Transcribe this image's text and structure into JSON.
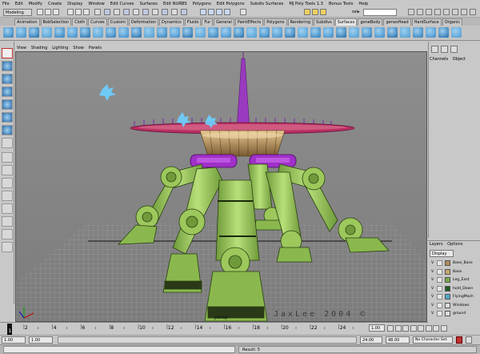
{
  "menubar": [
    "File",
    "Edit",
    "Modify",
    "Create",
    "Display",
    "Window",
    "Edit Curves",
    "Surfaces",
    "Edit NURBS",
    "Polygons",
    "Edit Polygons",
    "Subdiv Surfaces",
    "MJ Poly Tools 1.3",
    "Bonus Tools",
    "Help"
  ],
  "status": {
    "mode": "Modeling",
    "sel_label": "sel▸"
  },
  "shelf_tabs": [
    {
      "label": "Animation",
      "active": false
    },
    {
      "label": "BobSelection",
      "active": false
    },
    {
      "label": "Cloth",
      "active": false
    },
    {
      "label": "Curves",
      "active": false
    },
    {
      "label": "Custom",
      "active": false
    },
    {
      "label": "Deformation",
      "active": false
    },
    {
      "label": "Dynamics",
      "active": false
    },
    {
      "label": "Fluids",
      "active": false
    },
    {
      "label": "Fur",
      "active": false
    },
    {
      "label": "General",
      "active": false
    },
    {
      "label": "PaintEffects",
      "active": false
    },
    {
      "label": "Polygons",
      "active": false
    },
    {
      "label": "Rendering",
      "active": false
    },
    {
      "label": "Subdivs",
      "active": false
    },
    {
      "label": "Surfaces",
      "active": true
    },
    {
      "label": "geneBody",
      "active": false
    },
    {
      "label": "genesHead",
      "active": false
    },
    {
      "label": "HardSurface",
      "active": false
    },
    {
      "label": "Organic",
      "active": false
    }
  ],
  "panel_menu": [
    "View",
    "Shading",
    "Lighting",
    "Show",
    "Panels"
  ],
  "viewport": {
    "camera": "persp",
    "watermark": "JaxLee 2004 ©"
  },
  "channel_box": {
    "menus": [
      "Channels",
      "Object"
    ]
  },
  "layers": {
    "menus": [
      "Layers",
      "Options"
    ],
    "dropdown": "Display",
    "rows": [
      {
        "v": "V",
        "name": "Base_Base",
        "color": "#b08a5a"
      },
      {
        "v": "V",
        "name": "Base",
        "color": "#c8a870"
      },
      {
        "v": "V",
        "name": "Leg_East",
        "color": "#7aa84a"
      },
      {
        "v": "V",
        "name": "hold_Down",
        "color": "#1e5c1e"
      },
      {
        "v": "V",
        "name": "FlyingMach",
        "color": "#4caacc"
      },
      {
        "v": "V",
        "name": "Windows",
        "color": "#dcdcdc"
      },
      {
        "v": "V",
        "name": "ground",
        "color": "#dcdcdc"
      }
    ]
  },
  "timeline": {
    "ticks": [
      "2",
      "4",
      "6",
      "8",
      "10",
      "12",
      "14",
      "16",
      "18",
      "20",
      "22",
      "24"
    ],
    "current_frame": "1",
    "frame_field": "1.00"
  },
  "range": {
    "start": "1.00",
    "start2": "1.00",
    "end": "24.00",
    "end2": "48.00",
    "char_set": "No Character Set"
  },
  "command": {
    "result": "Result: 5"
  },
  "colors": {
    "ui_gray": "#c8c8c8",
    "viewport_gray": "#8a8a8a",
    "model_green": "#9ccf5c",
    "accent_magenta": "#c03cd8",
    "shelf_blue": "#2a7ab8"
  }
}
